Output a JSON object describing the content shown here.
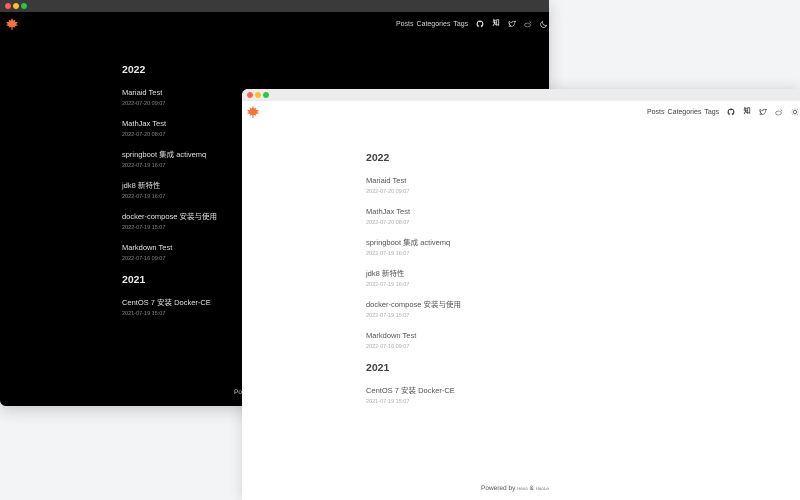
{
  "dark_window": {
    "nav": {
      "posts": "Posts",
      "categories": "Categories",
      "tags": "Tags"
    },
    "icons": [
      "github-icon",
      "zhihu-icon",
      "twitter-icon",
      "weibo-icon",
      "moon-icon"
    ],
    "zhihu_text": "知",
    "years": [
      {
        "year": "2022",
        "posts": [
          {
            "title": "Mariaid Test",
            "date": "2022-07-20 09:07"
          },
          {
            "title": "MathJax Test",
            "date": "2022-07-20 08:07"
          },
          {
            "title": "springboot 集成 activemq",
            "date": "2022-07-19 16:07"
          },
          {
            "title": "jdk8 新特性",
            "date": "2022-07-19 16:07"
          },
          {
            "title": "docker-compose 安装与使用",
            "date": "2022-07-19 15:07"
          },
          {
            "title": "Markdown Test",
            "date": "2022-07-16 09:07"
          }
        ]
      },
      {
        "year": "2021",
        "posts": [
          {
            "title": "CentOS 7 安装 Docker-CE",
            "date": "2021-07-19 15:07"
          }
        ]
      }
    ],
    "footer": {
      "text": "Po"
    }
  },
  "light_window": {
    "nav": {
      "posts": "Posts",
      "categories": "Categories",
      "tags": "Tags"
    },
    "icons": [
      "github-icon",
      "zhihu-icon",
      "twitter-icon",
      "weibo-icon",
      "sun-icon"
    ],
    "zhihu_text": "知",
    "years": [
      {
        "year": "2022",
        "posts": [
          {
            "title": "Mariaid Test",
            "date": "2022-07-20 09:07"
          },
          {
            "title": "MathJax Test",
            "date": "2022-07-20 08:07"
          },
          {
            "title": "springboot 集成 activemq",
            "date": "2022-07-19 16:07"
          },
          {
            "title": "jdk8 新特性",
            "date": "2022-07-19 16:07"
          },
          {
            "title": "docker-compose 安装与使用",
            "date": "2022-07-19 15:07"
          },
          {
            "title": "Markdown Test",
            "date": "2022-07-16 09:07"
          }
        ]
      },
      {
        "year": "2021",
        "posts": [
          {
            "title": "CentOS 7 安装 Docker-CE",
            "date": "2021-07-19 15:07"
          }
        ]
      }
    ],
    "footer": {
      "powered": "Powered by",
      "hexo": "Hexo",
      "amp": "&",
      "theme": "HaoLe"
    }
  },
  "colors": {
    "dark_bg": "#000000",
    "light_bg": "#ffffff",
    "page_bg": "#f3f4f6",
    "logo_orange": "#f4743b"
  }
}
